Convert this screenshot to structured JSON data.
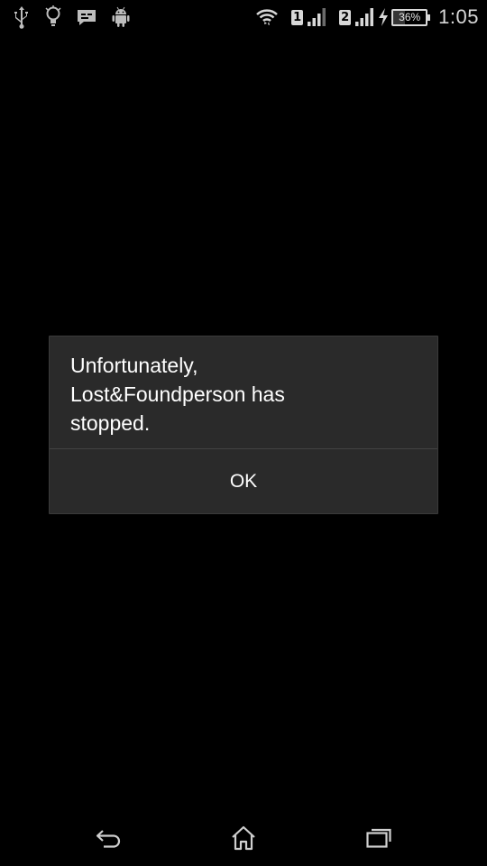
{
  "status_bar": {
    "left_icons": [
      "usb-icon",
      "lightbulb-icon",
      "message-icon",
      "android-debug-icon"
    ],
    "right_icons": [
      "wifi-icon",
      "sim1-signal-icon",
      "sim2-signal-icon",
      "charging-icon",
      "battery-icon"
    ],
    "sim1_label": "1",
    "sim2_label": "2",
    "battery_percent": "36%",
    "battery_level": 0.36,
    "time": "1:05"
  },
  "dialog": {
    "message": "Unfortunately,\nLost&Foundperson has\nstopped.",
    "ok_label": "OK"
  },
  "nav_bar": {
    "buttons": [
      "back-icon",
      "home-icon",
      "recents-icon"
    ]
  },
  "colors": {
    "background": "#000000",
    "dialog_bg": "#2a2a2a",
    "divider": "#434343",
    "text": "#ffffff",
    "status_icons": "#d8d8d8"
  }
}
